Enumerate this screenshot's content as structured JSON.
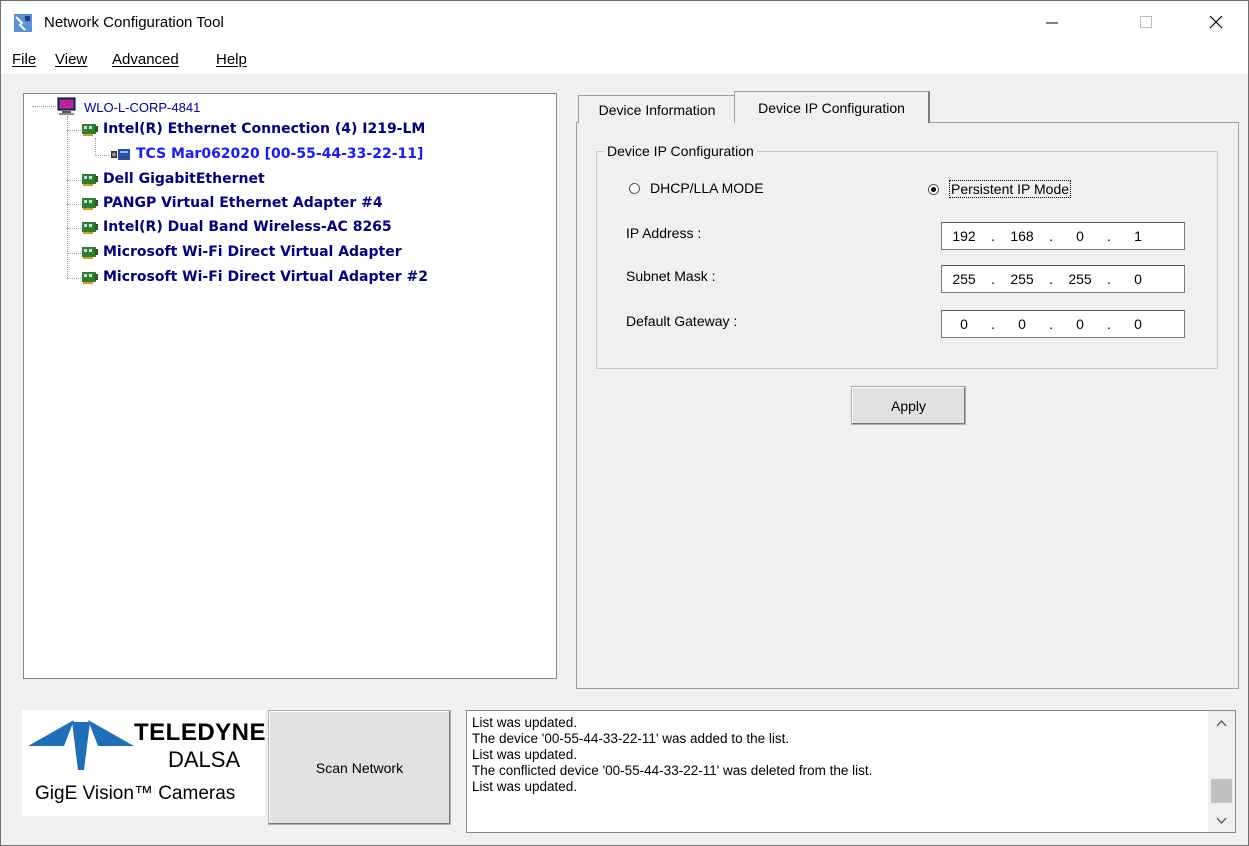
{
  "window": {
    "title": "Network Configuration Tool",
    "minimize_icon": "minimize-icon",
    "maximize_icon": "maximize-icon",
    "close_icon": "close-icon"
  },
  "menu": {
    "items": [
      {
        "label": "File",
        "mnemonic": "F"
      },
      {
        "label": "View",
        "mnemonic": "V"
      },
      {
        "label": "Advanced",
        "mnemonic": "A"
      },
      {
        "label": "Help",
        "mnemonic": "H"
      }
    ]
  },
  "tree": {
    "root": {
      "label": "WLO-L-CORP-4841",
      "icon": "computer-icon"
    },
    "adapters": [
      {
        "label": "Intel(R) Ethernet Connection (4) I219-LM",
        "icon": "network-card-icon"
      },
      {
        "label": "Dell GigabitEthernet",
        "icon": "network-card-icon"
      },
      {
        "label": "PANGP Virtual Ethernet Adapter #4",
        "icon": "network-card-icon"
      },
      {
        "label": "Intel(R) Dual Band Wireless-AC 8265",
        "icon": "network-card-icon"
      },
      {
        "label": "Microsoft Wi-Fi Direct Virtual Adapter",
        "icon": "network-card-icon"
      },
      {
        "label": "Microsoft Wi-Fi Direct Virtual Adapter #2",
        "icon": "network-card-icon"
      }
    ],
    "device": {
      "label": "TCS Mar062020 [00-55-44-33-22-11]",
      "icon": "camera-icon"
    }
  },
  "tabs": [
    {
      "label": "Device Information"
    },
    {
      "label": "Device IP Configuration",
      "selected": true
    }
  ],
  "ip_config": {
    "group_title": "Device IP Configuration",
    "dhcp_label": "DHCP/LLA MODE",
    "persistent_label": "Persistent IP Mode",
    "mode_selected": "Persistent IP Mode",
    "ip_address_label": "IP Address :",
    "subnet_mask_label": "Subnet Mask :",
    "gateway_label": "Default Gateway :",
    "ip_address": [
      "192",
      "168",
      "0",
      "1"
    ],
    "subnet_mask": [
      "255",
      "255",
      "255",
      "0"
    ],
    "gateway": [
      "0",
      "0",
      "0",
      "0"
    ],
    "apply_label": "Apply"
  },
  "bottom": {
    "logo_teledyne": "TELEDYNE",
    "logo_dalsa": "DALSA",
    "logo_gige": "GigE Vision™ Cameras",
    "scan_label": "Scan Network",
    "log_lines": [
      "List was updated.",
      "The device '00-55-44-33-22-11' was added to the list.",
      "List was updated.",
      "The conflicted device '00-55-44-33-22-11' was deleted from the list.",
      "List was updated."
    ]
  },
  "colors": {
    "root_text": "#0000a0",
    "adapter_text": "#000080",
    "device_text": "#1a1aff",
    "logo_blue": "#1f6fb8"
  }
}
